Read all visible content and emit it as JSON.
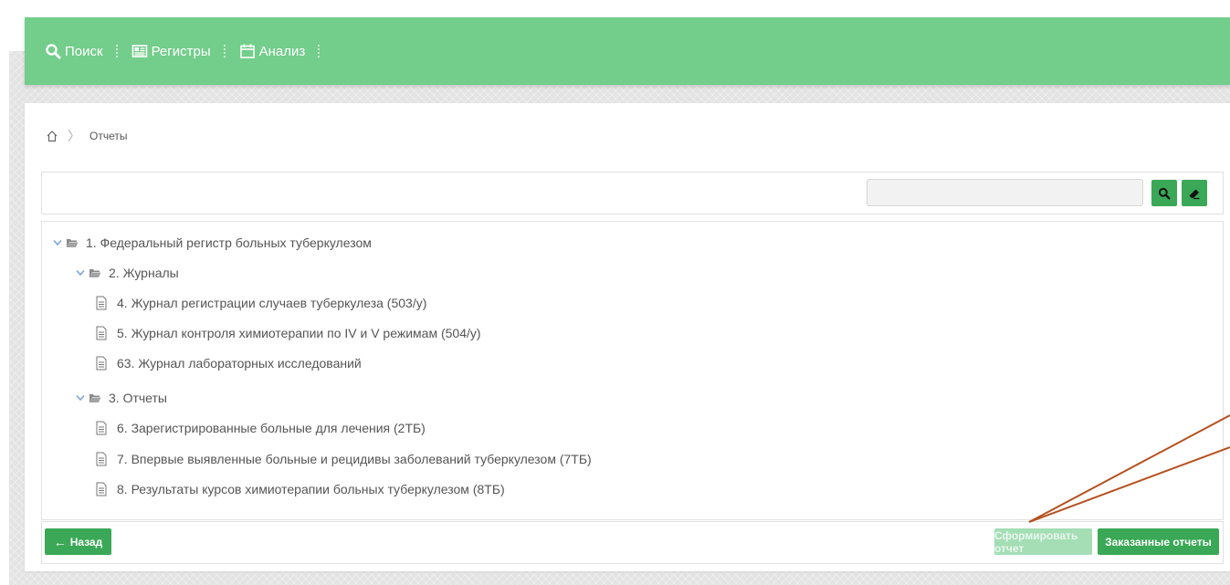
{
  "nav": {
    "items": [
      {
        "label": "Поиск",
        "icon": "search-icon"
      },
      {
        "label": "Регистры",
        "icon": "newspaper-icon"
      },
      {
        "label": "Анализ",
        "icon": "calendar-icon"
      }
    ]
  },
  "breadcrumb": {
    "home_icon": "home-icon",
    "current": "Отчеты"
  },
  "toolbar": {
    "search_value": "",
    "search_button_icon": "search-icon",
    "clear_button_icon": "eraser-icon"
  },
  "tree": {
    "items": [
      {
        "label": "1. Федеральный регистр больных туберкулезом",
        "type": "folder",
        "expanded": true
      },
      {
        "label": "2. Журналы",
        "type": "folder",
        "expanded": true
      },
      {
        "label": "4. Журнал регистрации случаев туберкулеза (503/у)",
        "type": "document"
      },
      {
        "label": "5. Журнал контроля химиотерапии по IV и V режимам (504/у)",
        "type": "document"
      },
      {
        "label": "63. Журнал лабораторных исследований",
        "type": "document"
      },
      {
        "label": "3. Отчеты",
        "type": "folder",
        "expanded": true
      },
      {
        "label": "6. Зарегистрированные больные для лечения (2ТБ)",
        "type": "document"
      },
      {
        "label": "7. Впервые выявленные больные и рецидивы заболеваний туберкулезом (7ТБ)",
        "type": "document"
      },
      {
        "label": "8. Результаты курсов химиотерапии больных туберкулезом (8ТБ)",
        "type": "document"
      }
    ]
  },
  "footer": {
    "back_label": "Назад",
    "generate_label": "Сформировать отчет",
    "ordered_label": "Заказанные отчеты"
  },
  "colors": {
    "navbar": "#73cd8b",
    "button": "#3aa856",
    "button_disabled": "#a5deb5",
    "annotation": "#b5501e"
  }
}
